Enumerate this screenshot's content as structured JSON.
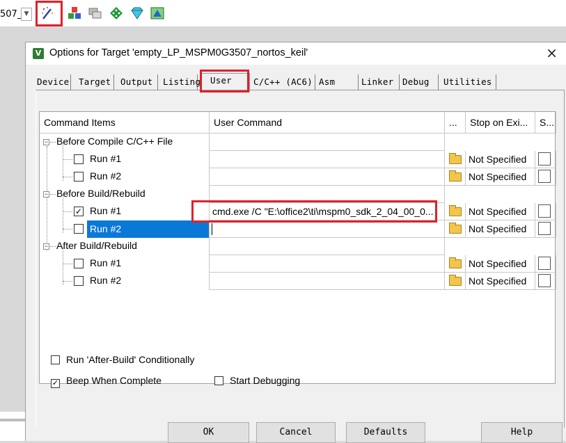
{
  "toolbar": {
    "combo_text": "507_",
    "icons": [
      "magic-wand-icon",
      "manage-components-icon",
      "copy-files-icon",
      "select-pack-icon",
      "diamond-tool-icon",
      "event-recorder-icon"
    ]
  },
  "dialog": {
    "title": "Options for Target 'empty_LP_MSPM0G3507_nortos_keil'",
    "close_label": "×",
    "tabs": [
      {
        "label": "Device"
      },
      {
        "label": "Target"
      },
      {
        "label": "Output"
      },
      {
        "label": "Listing"
      },
      {
        "label": "User"
      },
      {
        "label": "C/C++ (AC6)"
      },
      {
        "label": "Asm"
      },
      {
        "label": "Linker"
      },
      {
        "label": "Debug"
      },
      {
        "label": "Utilities"
      }
    ],
    "active_tab": "User"
  },
  "grid": {
    "headers": {
      "items": "Command Items",
      "command": "User Command",
      "browse": "...",
      "stop": "Stop on Exi...",
      "s": "S..."
    },
    "groups": [
      {
        "label": "Before Compile C/C++ File",
        "rows": [
          {
            "label": "Run #1",
            "checked": false,
            "command": "",
            "stop": "Not Specified"
          },
          {
            "label": "Run #2",
            "checked": false,
            "command": "",
            "stop": "Not Specified"
          }
        ]
      },
      {
        "label": "Before Build/Rebuild",
        "rows": [
          {
            "label": "Run #1",
            "checked": true,
            "command": "cmd.exe /C \"E:\\office2\\ti\\mspm0_sdk_2_04_00_0...",
            "stop": "Not Specified"
          },
          {
            "label": "Run #2",
            "checked": false,
            "command": "",
            "stop": "Not Specified",
            "selected": true
          }
        ]
      },
      {
        "label": "After Build/Rebuild",
        "rows": [
          {
            "label": "Run #1",
            "checked": false,
            "command": "",
            "stop": "Not Specified"
          },
          {
            "label": "Run #2",
            "checked": false,
            "command": "",
            "stop": "Not Specified"
          }
        ]
      }
    ]
  },
  "options": {
    "run_after_build": {
      "label": "Run 'After-Build' Conditionally",
      "checked": false
    },
    "beep": {
      "label": "Beep When Complete",
      "checked": true
    },
    "start_debugging": {
      "label": "Start Debugging",
      "checked": false
    }
  },
  "buttons": {
    "ok": "OK",
    "cancel": "Cancel",
    "defaults": "Defaults",
    "help": "Help"
  },
  "colors": {
    "highlight_box": "#e0212a",
    "selection": "#0a78d7"
  }
}
